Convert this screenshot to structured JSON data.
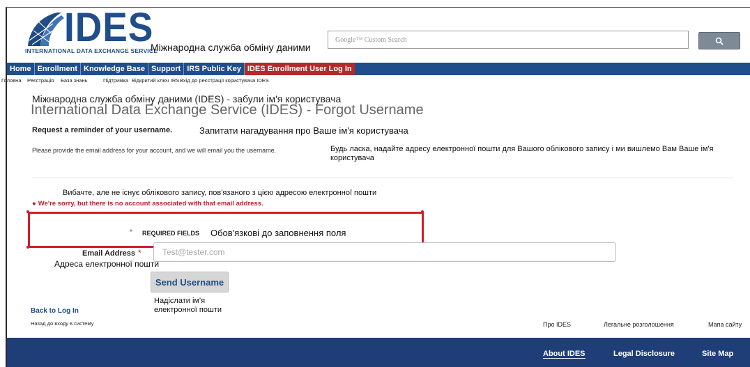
{
  "header": {
    "logo_text": "IDES",
    "logo_subtitle": "INTERNATIONAL DATA EXCHANGE SERVICE",
    "tagline_uk": "Міжнародна служба обміну даними",
    "search_placeholder": "Google™ Custom Search"
  },
  "nav": {
    "items": [
      {
        "label": "Home"
      },
      {
        "label": "Enrollment"
      },
      {
        "label": "Knowledge Base"
      },
      {
        "label": "Support"
      },
      {
        "label": "IRS Public Key"
      },
      {
        "label": "IDES Enrollment User Log In"
      }
    ],
    "sub_labels": [
      "Головна",
      "Реєстрація",
      "База знань",
      "Підтримка",
      "Відкритий ключ IRS",
      "Вхід до реєстрації користувача IDES"
    ]
  },
  "content": {
    "title_uk": "Міжнародна служба обміну даними (IDES) - забули ім'я користувача",
    "title": "International Data Exchange Service (IDES) - Forgot Username",
    "request": "Request a reminder of your username.",
    "request_uk": "Запитати нагадування про Ваше ім'я користувача",
    "provide": "Please provide the email address for your account, and we will email you the username.",
    "provide_uk": "Будь ласка, надайте адресу електронної пошти для Вашого облікового запису і ми вишлемо Вам Ваше ім'я користувача",
    "error_uk": "Вибачте, але не існує облікового запису, пов'язаного з цією адресою електронної пошти",
    "error": "We're sorry, but there is no account associated with that email address.",
    "required_star": "*",
    "required_fields": "REQUIRED FIELDS",
    "required_uk": "Обов'язкові до заповнення поля",
    "email_label": "Email Address",
    "email_placeholder": "Test@tester.com",
    "email_label_uk": "Адреса електронної пошти",
    "send_button": "Send Username",
    "send_button_uk": "Надіслати ім'я електронної пошти",
    "back_link": "Back to Log In",
    "back_link_uk": "Назад до входу в систему"
  },
  "footer": {
    "links_uk": [
      "Про IDES",
      "Легальне розголошення",
      "Мапа сайту"
    ],
    "links": [
      "About IDES",
      "Legal Disclosure",
      "Site Map"
    ]
  },
  "colors": {
    "brand_blue": "#1f4e8a",
    "footer_blue": "#1f3e78",
    "active_tab": "#b22a2a",
    "error_red": "#c0202a",
    "highlight_red": "#d41d2a"
  }
}
